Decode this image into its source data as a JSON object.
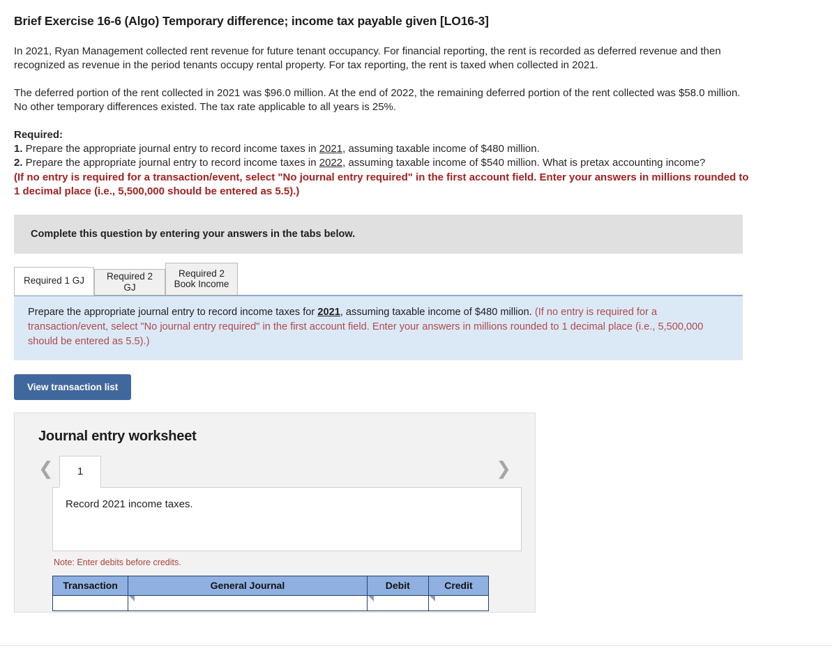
{
  "exercise": {
    "title": "Brief Exercise 16-6 (Algo) Temporary difference; income tax payable given [LO16-3]",
    "paragraph1": "In 2021, Ryan Management collected rent revenue for future tenant occupancy. For financial reporting, the rent is recorded as deferred revenue and then recognized as revenue in the period tenants occupy rental property. For tax reporting, the rent is taxed when collected in 2021.",
    "paragraph2": "The deferred portion of the rent collected in 2021 was $96.0 million. At the end of 2022, the remaining deferred portion of the rent collected was $58.0 million. No other temporary differences existed. The tax rate applicable to all years is 25%."
  },
  "required": {
    "heading": "Required:",
    "item1_number": "1.",
    "item1_pre": " Prepare the appropriate journal entry to record income taxes in ",
    "item1_year": "2021",
    "item1_post": ", assuming taxable income of $480 million.",
    "item2_number": "2.",
    "item2_pre": " Prepare the appropriate journal entry to record income taxes in ",
    "item2_year": "2022",
    "item2_post": ", assuming taxable income of $540 million.  What is pretax accounting income?",
    "note_red": "(If no entry is required for a transaction/event, select \"No journal entry required\" in the first account field. Enter your answers in millions rounded to 1 decimal place (i.e., 5,500,000 should be entered as 5.5).)"
  },
  "banner": {
    "text": "Complete this question by entering your answers in the tabs below."
  },
  "tabs": [
    {
      "label": "Required 1 GJ",
      "active": true
    },
    {
      "label": "Required 2 GJ",
      "active": false
    },
    {
      "label_line1": "Required 2",
      "label_line2": "Book Income",
      "active": false
    }
  ],
  "blue_panel": {
    "pre": "Prepare the appropriate journal entry to record income taxes for ",
    "year": "2021",
    "mid": ", assuming taxable income of $480 million. ",
    "red": "(If no entry is required for a transaction/event, select \"No journal entry required\" in the first account field. Enter your answers in millions rounded to 1 decimal place (i.e., 5,500,000 should be entered as 5.5).)"
  },
  "buttons": {
    "view_transaction_list": "View transaction list"
  },
  "worksheet": {
    "title": "Journal entry worksheet",
    "prev_icon": "chevron-left",
    "next_icon": "chevron-right",
    "current_page": "1",
    "description": "Record 2021 income taxes.",
    "note": "Note: Enter debits before credits.",
    "table": {
      "headers": [
        "Transaction",
        "General Journal",
        "Debit",
        "Credit"
      ],
      "rows": [
        {
          "transaction": "",
          "general_journal": "",
          "debit": "",
          "credit": ""
        }
      ]
    }
  },
  "colors": {
    "accent_blue": "#41689c",
    "table_header_blue": "#8fb0e0",
    "panel_blue": "#dbe9f7",
    "banner_gray": "#e0e0e0",
    "red_bold": "#a32121",
    "red_soft": "#b04a4a",
    "note_red": "#a8443c"
  }
}
